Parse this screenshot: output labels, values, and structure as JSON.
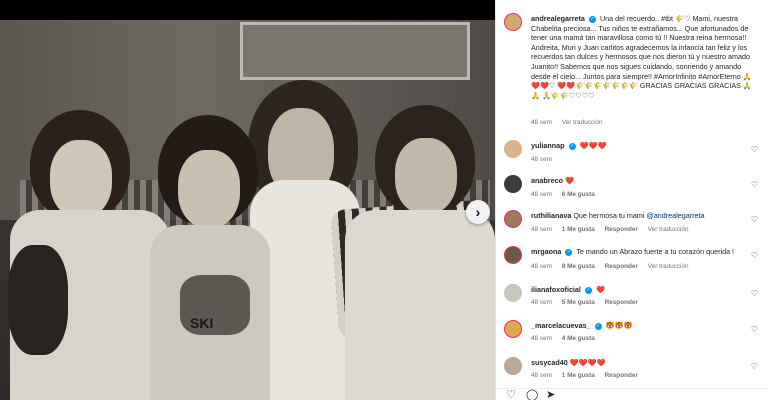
{
  "post": {
    "photo_shirt_text": "SKI",
    "caption_user": "andrealegarreta",
    "caption_text": "Una del recuerdo.. #tbt 🌾♡ Mami, nuestra Chabelita preciosa... Tus niños te extrañamos... Que afortunados de tener una mamá tan maravillosa como tú !! Nuestra reina hermosa!! Andreita, Muri y Juan carlitos agradecemos la infancia tan feliz y los recuerdos tan dulces y hermosos que nos dieron tú y nuestro amado Juanito!! Sabemos que nos sigues cuidando, sonriendo y amando desde el cielo... Juntos para siempre!! #AmorInfinito #AmorEterno 🙏❤️❤️♡ ❤️❤️🌾🌾🌾🌾🌾🌾🌾 GRACIAS GRACIAS GRACIAS 🙏🙏 🙏🌾🌾♡♡♡♡",
    "caption_time": "48 sem",
    "caption_translate": "Ver traducción"
  },
  "comments": [
    {
      "user": "yuliannap",
      "text": "❤️❤️❤️",
      "time": "48 sem",
      "likes": "",
      "reply": "",
      "translate": "",
      "avatar_color": "#d9b38c"
    },
    {
      "user": "anabreco",
      "text": "❤️",
      "time": "48 sem",
      "likes": "6 Me gusta",
      "reply": "",
      "translate": "",
      "avatar_color": "#3b3b3b"
    },
    {
      "user": "ruthilianava",
      "text": "Que hermosa tu mami ",
      "mention": "@andrealegarreta",
      "time": "48 sem",
      "likes": "1 Me gusta",
      "reply": "Responder",
      "translate": "Ver traducción",
      "avatar_color": "#9c7a5b"
    },
    {
      "user": "mrgaona",
      "text": "Te mando un Abrazo fuerte a tu corazón querida !",
      "time": "48 sem",
      "likes": "8 Me gusta",
      "reply": "Responder",
      "translate": "Ver traducción",
      "avatar_color": "#6b5a44"
    },
    {
      "user": "ilianafoxoficial",
      "text": "❤️",
      "time": "48 sem",
      "likes": "5 Me gusta",
      "reply": "Responder",
      "translate": "",
      "avatar_color": "#c9c4bd"
    },
    {
      "user": "_marcelacuevas_",
      "text": "🐯🐯🐯",
      "time": "48 sem",
      "likes": "4 Me gusta",
      "reply": "",
      "translate": "",
      "avatar_color": "#e0a64c"
    },
    {
      "user": "susycad40",
      "text": "❤️❤️❤️❤️",
      "time": "48 sem",
      "likes": "1 Me gusta",
      "reply": "Responder",
      "translate": "",
      "avatar_color": "#b9a99a"
    }
  ],
  "icons": {
    "like": "heart-icon",
    "comment": "comment-icon",
    "share": "share-icon",
    "next": "chevron-right-icon"
  },
  "colors": {
    "verified": "#0095f6",
    "link": "#00376b",
    "meta": "#737373",
    "heart_red": "#ed1c3a"
  }
}
